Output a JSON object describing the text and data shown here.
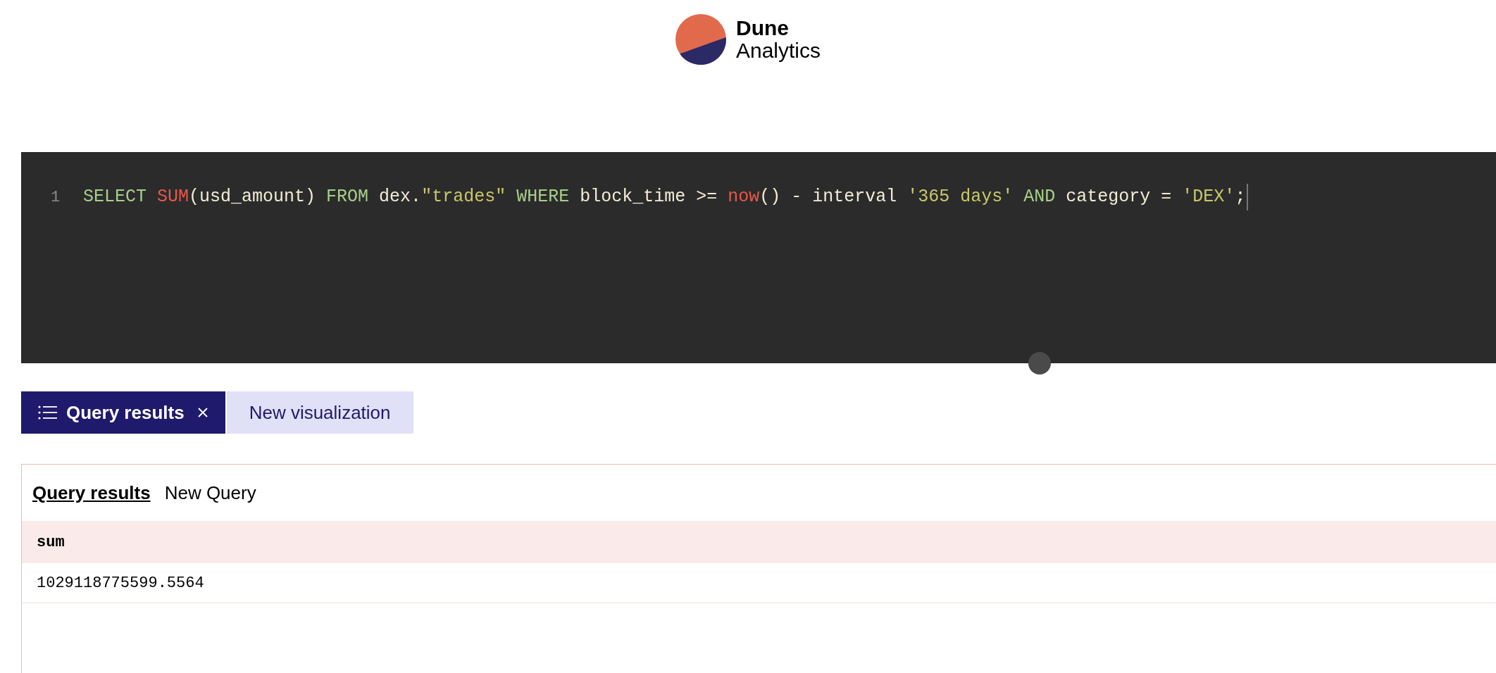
{
  "logo": {
    "line_1": "Dune",
    "line_2": "Analytics"
  },
  "editor": {
    "lines": [
      {
        "number": "1",
        "tokens": [
          {
            "kind": "keyword",
            "text": "SELECT "
          },
          {
            "kind": "function",
            "text": "SUM"
          },
          {
            "kind": "plain",
            "text": "(usd_amount) "
          },
          {
            "kind": "keyword",
            "text": "FROM "
          },
          {
            "kind": "plain",
            "text": "dex."
          },
          {
            "kind": "string",
            "text": "\"trades\" "
          },
          {
            "kind": "keyword",
            "text": "WHERE "
          },
          {
            "kind": "plain",
            "text": "block_time >= "
          },
          {
            "kind": "function",
            "text": "now"
          },
          {
            "kind": "plain",
            "text": "() - interval "
          },
          {
            "kind": "string",
            "text": "'365 days' "
          },
          {
            "kind": "keyword",
            "text": "AND "
          },
          {
            "kind": "plain",
            "text": "category = "
          },
          {
            "kind": "string",
            "text": "'DEX'"
          },
          {
            "kind": "plain",
            "text": ";"
          }
        ]
      }
    ]
  },
  "tabs": [
    {
      "label": "Query results",
      "selected": true,
      "closable": true
    },
    {
      "label": "New visualization",
      "selected": false,
      "closable": false
    }
  ],
  "results": {
    "subtabs": [
      {
        "label": "Query results",
        "selected": true
      },
      {
        "label": "New Query",
        "selected": false
      }
    ],
    "table": {
      "columns": [
        "sum"
      ],
      "rows": [
        [
          "1029118775599.5564"
        ]
      ]
    }
  }
}
